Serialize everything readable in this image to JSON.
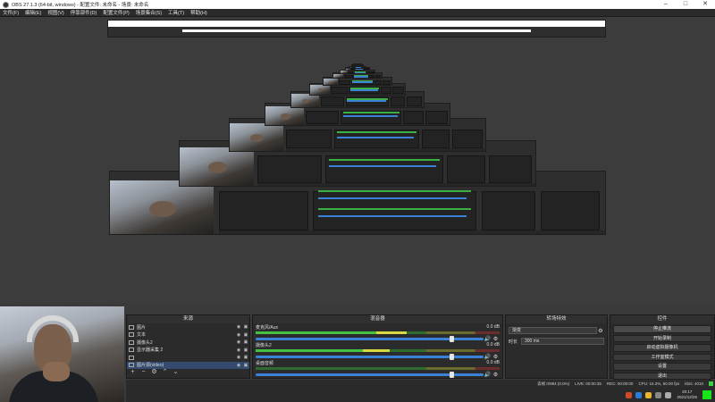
{
  "window": {
    "title": "OBS 27.1.3 (64-bit, windows) - 配置文件: 未命名 - 场景: 未命名",
    "controls": [
      "–",
      "□",
      "✕"
    ]
  },
  "menu": [
    "文件(F)",
    "编辑(E)",
    "视图(V)",
    "停靠部件(D)",
    "配置文件(P)",
    "场景集合(S)",
    "工具(T)",
    "帮助(H)"
  ],
  "docks": {
    "sources_title": "来源",
    "mixer_title": "混音器",
    "transitions_title": "转场特效",
    "controls_title": "控件"
  },
  "sources": [
    {
      "label": "图片",
      "icon": "image-icon"
    },
    {
      "label": "文本",
      "icon": "text-icon"
    },
    {
      "label": "摄像头2",
      "icon": "camera-icon"
    },
    {
      "label": "显示器采集 2",
      "icon": "monitor-icon"
    },
    {
      "label": "",
      "icon": "audio-icon"
    },
    {
      "label": "图片源(video)",
      "icon": "image-icon"
    }
  ],
  "mixer": [
    {
      "name": "麦克风/Aux",
      "db": "0.0 dB",
      "level": 0.62,
      "volume": 0.86
    },
    {
      "name": "摄像头2",
      "db": "0.0 dB",
      "level": 0.55,
      "volume": 0.86
    },
    {
      "name": "桌面音频",
      "db": "0.0 dB",
      "level": 0.0,
      "volume": 0.86
    }
  ],
  "transitions": {
    "selected": "渐变",
    "duration_label": "时长",
    "duration_value": "300 ms"
  },
  "controls": [
    "停止推流",
    "开始录制",
    "启动虚拟摄像机",
    "工作室模式",
    "设置",
    "退出"
  ],
  "status": {
    "dropped": "丢帧 0/984 (0.0%)",
    "live": "LIVE: 00:00:35",
    "rec": "REC: 00:00:00",
    "cpu": "CPU: 15.3%, 60.00 fps",
    "kbps": "kb/s: 4010"
  },
  "taskbar": {
    "time": "20:17",
    "date": "2021/12/25"
  }
}
